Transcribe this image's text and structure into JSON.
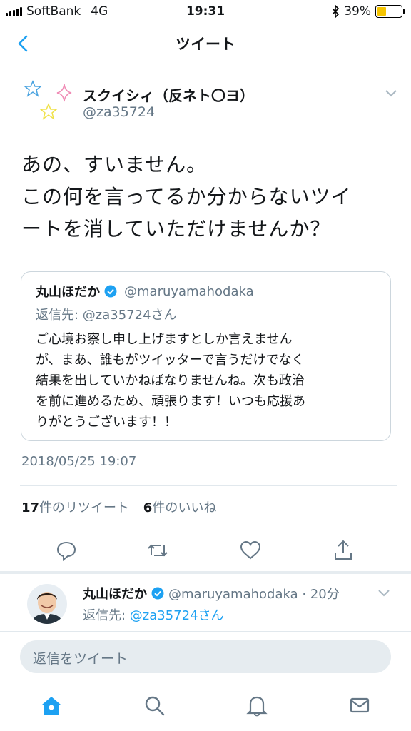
{
  "status_bar": {
    "carrier": "SoftBank",
    "network": "4G",
    "time": "19:31",
    "battery": "39%"
  },
  "nav": {
    "title": "ツイート"
  },
  "tweet": {
    "author_name": "スクイシィ（反ネト〇ヨ）",
    "author_handle": "@za35724",
    "text_lines": [
      "あの、すいません。",
      "この何を言ってるか分からないツイ",
      "ートを消していただけませんか？"
    ],
    "timestamp": "2018/05/25 19:07",
    "retweet_count": "17",
    "retweet_label": "件のリツイート",
    "like_count": "6",
    "like_label": "件のいいね"
  },
  "quoted": {
    "name": "丸山ほだか",
    "handle": "@maruyamahodaka",
    "reply_to": "返信先: @za35724さん",
    "body_lines": [
      "ご心境お察し申し上げますとしか言えません",
      "が、まあ、誰もがツイッターで言うだけでなく",
      "結果を出していかねばなりませんね。次も政治",
      "を前に進めるため、頑張ります！いつも応援あ",
      "りがとうございます！！"
    ]
  },
  "actions": [
    "reply-icon",
    "retweet-icon",
    "like-icon",
    "share-icon"
  ],
  "reply_tweet": {
    "name": "丸山ほだか",
    "handle_time": "@maruyamahodaka · 20分",
    "reply_prefix": "返信先: ",
    "reply_link": "@za35724さん"
  },
  "composer": {
    "placeholder": "返信をツイート"
  },
  "tabbar": [
    "home-icon",
    "search-icon",
    "notifications-icon",
    "messages-icon"
  ],
  "colors": {
    "accent": "#1da1f2",
    "muted": "#657786",
    "verified": "#1da1f2"
  }
}
